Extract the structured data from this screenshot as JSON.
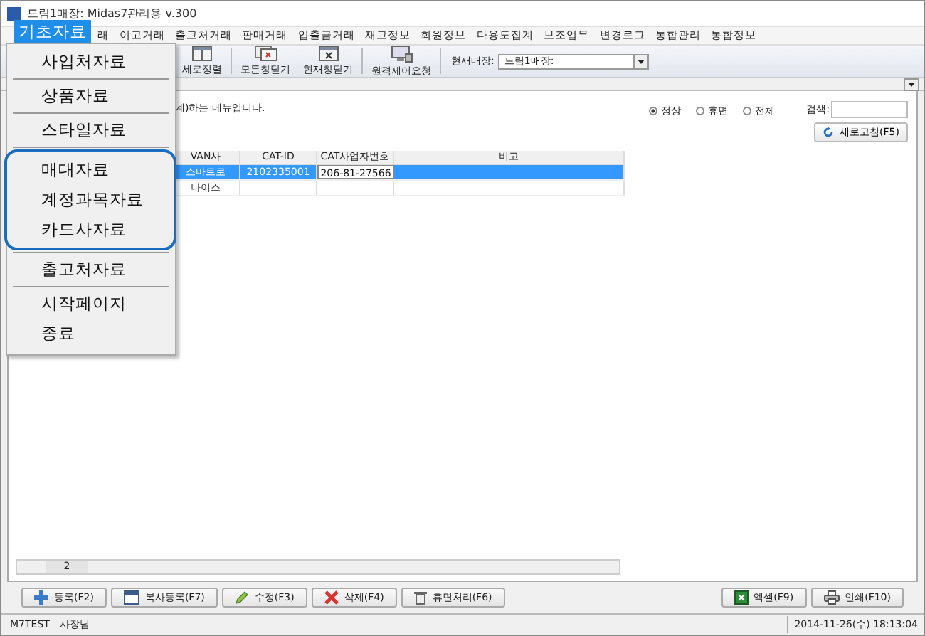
{
  "window": {
    "title": "드림1매장: Midas7관리용 v.300"
  },
  "menubar": [
    {
      "label": "래",
      "selected": false
    },
    {
      "label": "이고거래",
      "selected": false
    },
    {
      "label": "출고처거래",
      "selected": false
    },
    {
      "label": "판매거래",
      "selected": false
    },
    {
      "label": "입출금거래",
      "selected": false
    },
    {
      "label": "재고정보",
      "selected": false
    },
    {
      "label": "회원정보",
      "selected": false
    },
    {
      "label": "다용도집계",
      "selected": false
    },
    {
      "label": "보조업무",
      "selected": false
    },
    {
      "label": "변경로그",
      "selected": false
    },
    {
      "label": "통합관리",
      "selected": false
    },
    {
      "label": "통합정보",
      "selected": false
    }
  ],
  "toolbar": [
    {
      "label": "세로정렬",
      "kind": "tile"
    },
    {
      "label": "모든창닫기",
      "kind": "closeall"
    },
    {
      "label": "현재창닫기",
      "kind": "close"
    },
    {
      "label": "원격제어요청",
      "kind": "remote"
    }
  ],
  "store": {
    "label": "현재매장:",
    "value": "드림1매장:"
  },
  "open_menu": {
    "title": "기초자료",
    "groups": [
      {
        "highlighted": false,
        "items": [
          "사입처자료"
        ]
      },
      {
        "highlighted": false,
        "items": [
          "상품자료"
        ]
      },
      {
        "highlighted": false,
        "items": [
          "스타일자료"
        ]
      },
      {
        "highlighted": true,
        "items": [
          "매대자료",
          "계정과목자료",
          "카드사자료"
        ]
      },
      {
        "highlighted": false,
        "items": [
          "출고처자료"
        ]
      },
      {
        "highlighted": false,
        "items": [
          "시작페이지",
          "종료"
        ]
      }
    ]
  },
  "description": "계)하는 메뉴입니다.",
  "filters": [
    {
      "label": "정상",
      "selected": true
    },
    {
      "label": "휴면",
      "selected": false
    },
    {
      "label": "전체",
      "selected": false
    }
  ],
  "search": {
    "label": "검색:"
  },
  "refresh_button": "새로고침(F5)",
  "table": {
    "columns": [
      "VAN사",
      "CAT-ID",
      "CAT사업자번호",
      "비고"
    ],
    "rows": [
      {
        "selected": true,
        "cells": [
          "스마트로",
          "2102335001",
          "206-81-27566",
          ""
        ]
      },
      {
        "selected": false,
        "cells": [
          "나이스",
          "",
          "",
          ""
        ]
      }
    ],
    "footer_count": "2"
  },
  "buttons_left": [
    {
      "label": "등록(F2)",
      "kind": "add"
    },
    {
      "label": "복사등록(F7)",
      "kind": "copy"
    },
    {
      "label": "수정(F3)",
      "kind": "edit"
    },
    {
      "label": "삭제(F4)",
      "kind": "delete"
    },
    {
      "label": "휴면처리(F6)",
      "kind": "dormant"
    }
  ],
  "buttons_right": [
    {
      "label": "엑셀(F9)",
      "kind": "excel"
    },
    {
      "label": "인쇄(F10)",
      "kind": "print"
    }
  ],
  "status_bar": {
    "user": "M7TEST",
    "role": "사장님",
    "datetime": "2014-11-26(수) 18:13:04"
  }
}
